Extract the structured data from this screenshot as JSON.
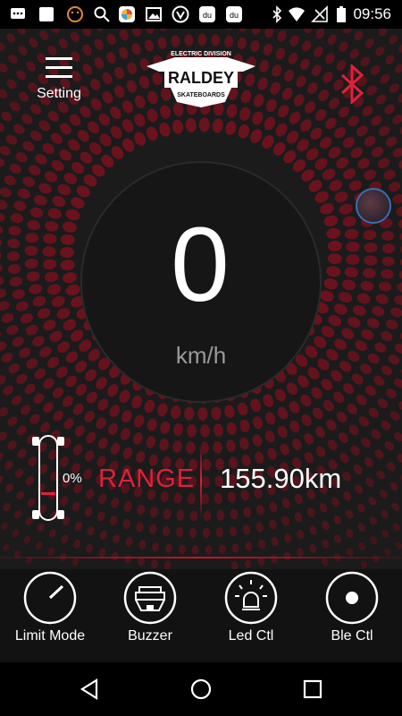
{
  "status_bar": {
    "time": "09:56",
    "left_icons": [
      "chat-icon",
      "square-icon",
      "face-icon",
      "search-icon",
      "color-app-icon",
      "image-icon",
      "shield-icon",
      "du-icon",
      "du-icon"
    ],
    "right_icons": [
      "bluetooth-icon",
      "wifi-icon",
      "no-sim-icon",
      "battery-icon"
    ]
  },
  "header": {
    "menu_label": "Setting",
    "logo_text": "RALDEY",
    "logo_top": "ELECTRIC DIVISION",
    "logo_bottom": "SKATEBOARDS"
  },
  "speed": {
    "value": "0",
    "unit": "km/h"
  },
  "battery": {
    "percent_text": "0%",
    "level": 0
  },
  "range": {
    "label": "RANGE",
    "value": "155.90km"
  },
  "controls": [
    {
      "label": "Limit Mode",
      "icon": "gauge-icon"
    },
    {
      "label": "Buzzer",
      "icon": "horn-icon"
    },
    {
      "label": "Led Ctl",
      "icon": "bulb-icon"
    },
    {
      "label": "Ble Ctl",
      "icon": "record-icon"
    }
  ],
  "colors": {
    "accent": "#e0203b",
    "background": "#1b1b1b"
  }
}
